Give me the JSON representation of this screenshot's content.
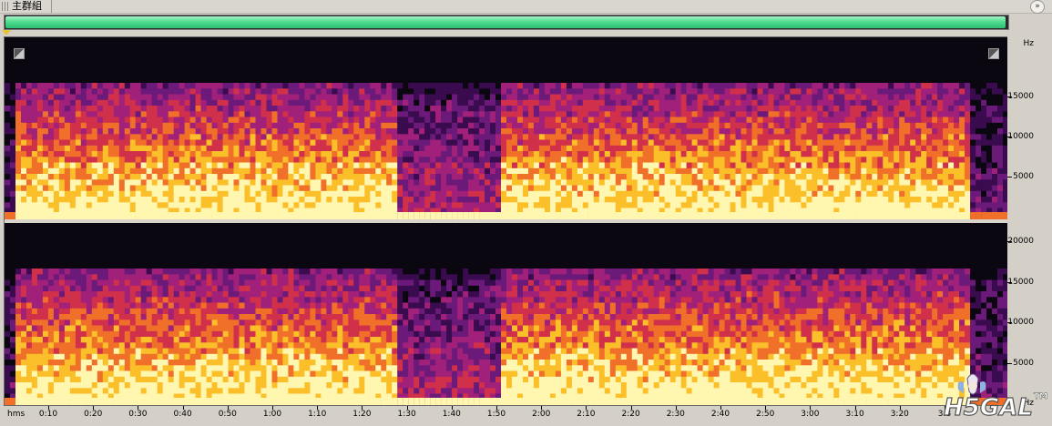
{
  "window": {
    "title": "主群組",
    "menu_glyph": "»"
  },
  "overview": {
    "fill_fraction": 0.998,
    "color": "#4fdc8e"
  },
  "spectrogram": {
    "frequency_unit": "Hz",
    "top_channel_ticks": [
      "15000",
      "10000",
      "5000"
    ],
    "bottom_channel_ticks": [
      "20000",
      "15000",
      "10000",
      "5000",
      "Hz"
    ],
    "time_unit_label": "hms",
    "time_ticks": [
      "0:10",
      "0:20",
      "0:30",
      "0:40",
      "0:50",
      "1:00",
      "1:10",
      "1:20",
      "1:30",
      "1:40",
      "1:50",
      "2:00",
      "2:10",
      "2:20",
      "2:30",
      "2:40",
      "2:50",
      "3:00",
      "3:10",
      "3:20",
      "3:3"
    ],
    "palette": [
      "#0b0710",
      "#3a0b4e",
      "#6b1a7a",
      "#a0207a",
      "#d0304a",
      "#f0702a",
      "#fbbf2a",
      "#fff7b0"
    ]
  },
  "watermark": {
    "text": "H5GAL",
    "mark": "TM"
  }
}
